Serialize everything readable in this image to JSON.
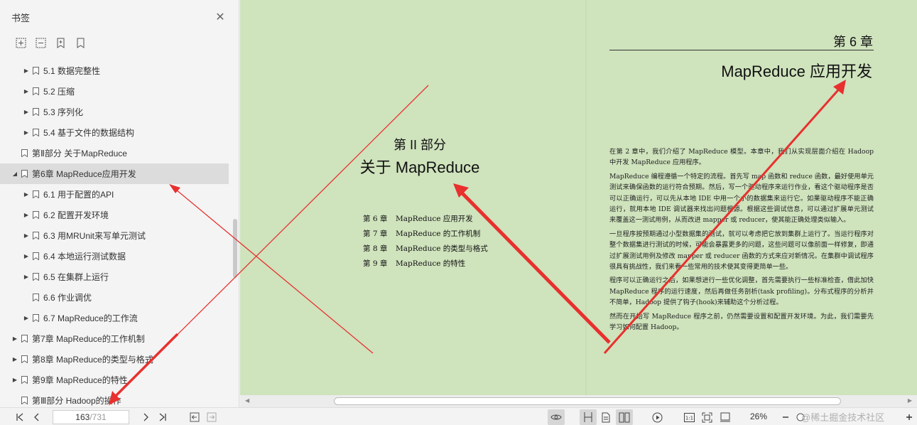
{
  "sidebar": {
    "title": "书签",
    "items": [
      {
        "label": "5.1 数据完整性",
        "level": 2,
        "caret": "right"
      },
      {
        "label": "5.2 压缩",
        "level": 2,
        "caret": "right"
      },
      {
        "label": "5.3 序列化",
        "level": 2,
        "caret": "right"
      },
      {
        "label": "5.4 基于文件的数据结构",
        "level": 2,
        "caret": "right"
      },
      {
        "label": "第Ⅱ部分 关于MapReduce",
        "level": 1,
        "caret": "none"
      },
      {
        "label": "第6章 MapReduce应用开发",
        "level": 1,
        "caret": "down",
        "selected": true
      },
      {
        "label": "6.1 用于配置的API",
        "level": 2,
        "caret": "right"
      },
      {
        "label": "6.2 配置开发环境",
        "level": 2,
        "caret": "right"
      },
      {
        "label": "6.3 用MRUnit来写单元测试",
        "level": 2,
        "caret": "right"
      },
      {
        "label": "6.4 本地运行测试数据",
        "level": 2,
        "caret": "right"
      },
      {
        "label": "6.5 在集群上运行",
        "level": 2,
        "caret": "right"
      },
      {
        "label": "6.6 作业调优",
        "level": 2,
        "caret": "none"
      },
      {
        "label": "6.7 MapReduce的工作流",
        "level": 2,
        "caret": "right"
      },
      {
        "label": "第7章 MapReduce的工作机制",
        "level": 1,
        "caret": "right"
      },
      {
        "label": "第8章 MapReduce的类型与格式",
        "level": 1,
        "caret": "right"
      },
      {
        "label": "第9章 MapReduce的特性",
        "level": 1,
        "caret": "right"
      },
      {
        "label": "第Ⅲ部分 Hadoop的操作",
        "level": 1,
        "caret": "none"
      }
    ]
  },
  "left_page": {
    "part": "第 II 部分",
    "part_title": "关于 MapReduce",
    "toc": [
      {
        "num": "第 6 章",
        "title": "MapReduce 应用开发"
      },
      {
        "num": "第 7 章",
        "title": "MapReduce 的工作机制"
      },
      {
        "num": "第 8 章",
        "title": "MapReduce 的类型与格式"
      },
      {
        "num": "第 9 章",
        "title": "MapReduce 的特性"
      }
    ]
  },
  "right_page": {
    "chapter_no": "第 6 章",
    "chapter_title": "MapReduce 应用开发",
    "paragraphs": [
      "在第 2 章中，我们介绍了 MapReduce 模型。本章中，我们从实现层面介绍在 Hadoop 中开发 MapReduce 应用程序。",
      "MapReduce 编程遵循一个特定的流程。首先写 map 函数和 reduce 函数，最好使用单元测试来确保函数的运行符合预期。然后，写一个驱动程序来运行作业，看这个驱动程序是否可以正确运行，可以先从本地 IDE 中用一个小的数据集来运行它。如果驱动程序不能正确运行，就用本地 IDE 调试器来找出问题根源。根据这些调试信息，可以通过扩展单元测试来覆盖这一测试用例，从而改进 mapper 或 reducer，使其能正确处理类似输入。",
      "一旦程序按预期通过小型数据集的测试，就可以考虑把它放到集群上运行了。当运行程序对整个数据集进行测试的时候，可能会暴露更多的问题，这些问题可以像前面一样修复，即通过扩展测试用例及修改 mapper 或 reducer 函数的方式来应对新情况。在集群中调试程序很具有挑战性，我们来看一些常用的技术使其变得更简单一些。",
      "程序可以正确运行之后，如果想进行一些优化调整，首先需要执行一些标准检查，借此加快 MapReduce 程序的运行速度，然后再做任务剖析(task profiling)。分布式程序的分析并不简单，Hadoop 提供了钩子(hook)来辅助这个分析过程。",
      "然而在开始写 MapReduce 程序之前，仍然需要设置和配置开发环境。为此，我们需要先学习如何配置 Hadoop。"
    ]
  },
  "toolbar": {
    "page_current": "163",
    "page_total": "/731",
    "zoom": "26%",
    "watermark": "@稀土掘金技术社区"
  },
  "colors": {
    "page_bg": "#cfe3bd",
    "arrow": "#e8302e",
    "selected": "#dcdcdc"
  }
}
